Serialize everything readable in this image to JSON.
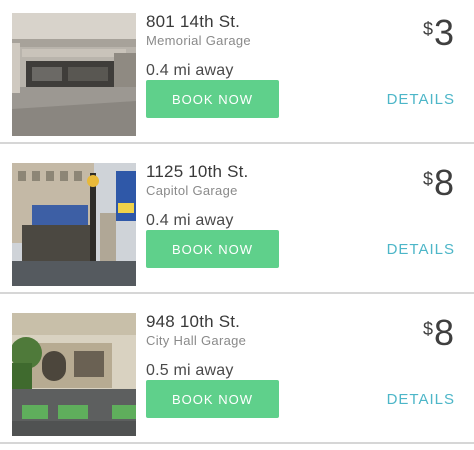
{
  "listings": [
    {
      "address": "801 14th St.",
      "garage": "Memorial Garage",
      "distance": "0.4 mi away",
      "book_label": "BOOK NOW",
      "currency": "$",
      "price": "3",
      "details_label": "DETAILS"
    },
    {
      "address": "1125 10th St.",
      "garage": "Capitol Garage",
      "distance": "0.4 mi away",
      "book_label": "BOOK NOW",
      "currency": "$",
      "price": "8",
      "details_label": "DETAILS"
    },
    {
      "address": "948 10th St.",
      "garage": "City Hall Garage",
      "distance": "0.5 mi away",
      "book_label": "BOOK NOW",
      "currency": "$",
      "price": "8",
      "details_label": "DETAILS"
    }
  ],
  "colors": {
    "book_button": "#5fd08b",
    "details_link": "#4db6c8",
    "divider": "#d6d6d6"
  }
}
